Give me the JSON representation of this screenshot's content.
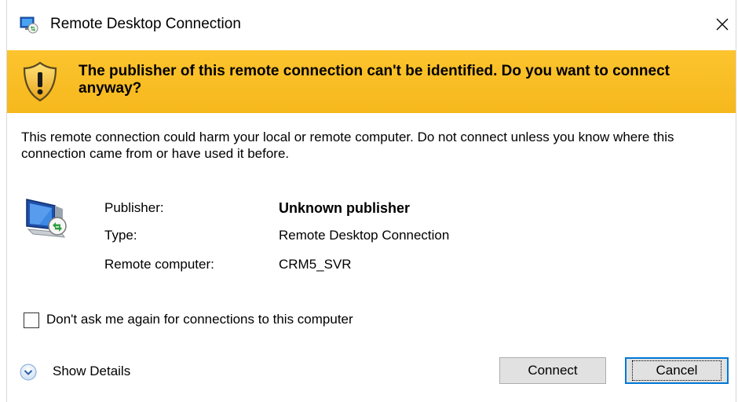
{
  "window": {
    "title": "Remote Desktop Connection",
    "close_icon": "close-icon",
    "app_icon": "remote-desktop-icon"
  },
  "banner": {
    "icon": "warning-shield-icon",
    "heading": "The publisher of this remote connection can't be identified. Do you want to connect anyway?",
    "color": "#fbc02d"
  },
  "message": "This remote connection could harm your local or remote computer. Do not connect unless you know where this connection came from or have used it before.",
  "details": {
    "icon": "computer-remote-icon",
    "rows": [
      {
        "label": "Publisher:",
        "value": "Unknown publisher"
      },
      {
        "label": "Type:",
        "value": "Remote Desktop Connection"
      },
      {
        "label": "Remote computer:",
        "value": "CRM5_SVR"
      }
    ]
  },
  "checkbox": {
    "label": "Don't ask me again for connections to this computer",
    "checked": false
  },
  "show_details": {
    "label": "Show Details",
    "icon": "chevron-down-circle-icon"
  },
  "buttons": {
    "connect": "Connect",
    "cancel": "Cancel"
  },
  "colors": {
    "accent": "#0078d7",
    "banner": "#fbc02d"
  }
}
